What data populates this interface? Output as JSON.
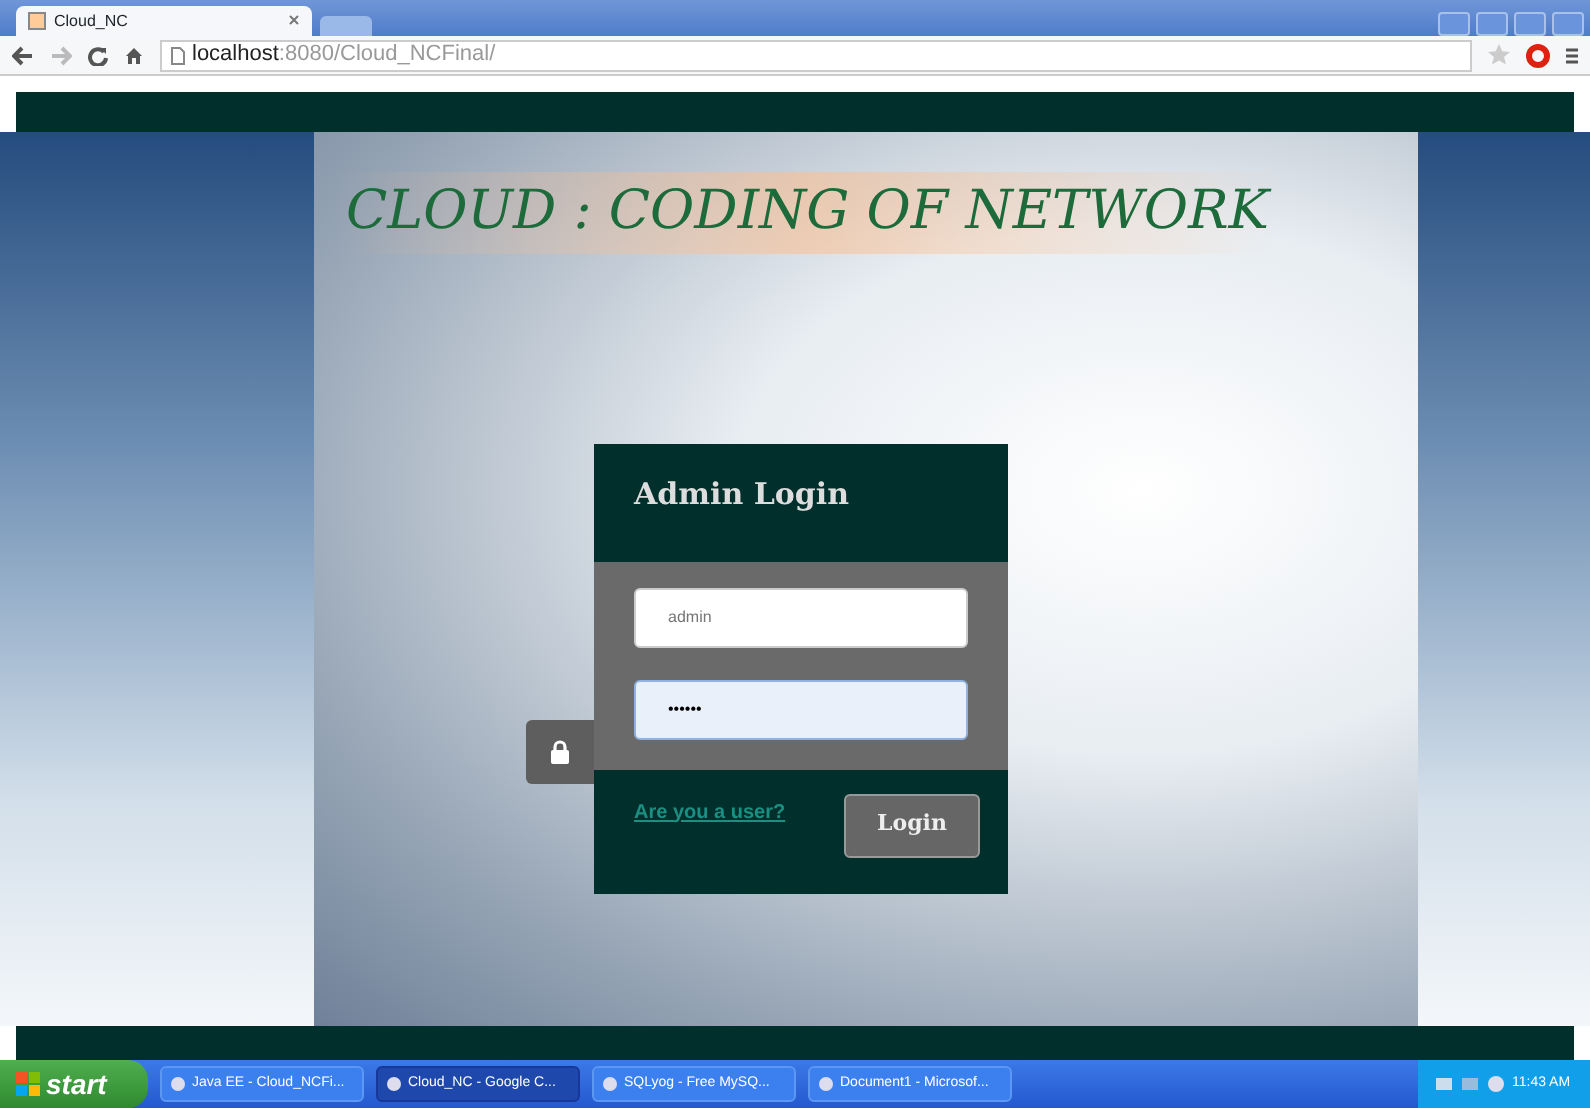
{
  "browser": {
    "tabs": [
      {
        "title": "Cloud_NC",
        "selected": true
      }
    ],
    "address": {
      "host": "localhost",
      "path": ":8080/Cloud_NCFinal/"
    }
  },
  "page": {
    "heading": "CLOUD : CODING OF NETWORK",
    "login": {
      "title": "Admin Login",
      "username": {
        "placeholder": "admin"
      },
      "password": {
        "value": "••••••",
        "focused": true
      },
      "user_link": "Are you a user?",
      "button": "Login"
    }
  },
  "taskbar": {
    "start": "start",
    "items": [
      {
        "label": "Java EE - Cloud_NCFi...",
        "selected": false
      },
      {
        "label": "Cloud_NC - Google C...",
        "selected": true
      },
      {
        "label": "SQLyog - Free MySQ...",
        "selected": false
      },
      {
        "label": "Document1 - Microsof...",
        "selected": false
      }
    ],
    "clock": "11:43 AM"
  }
}
